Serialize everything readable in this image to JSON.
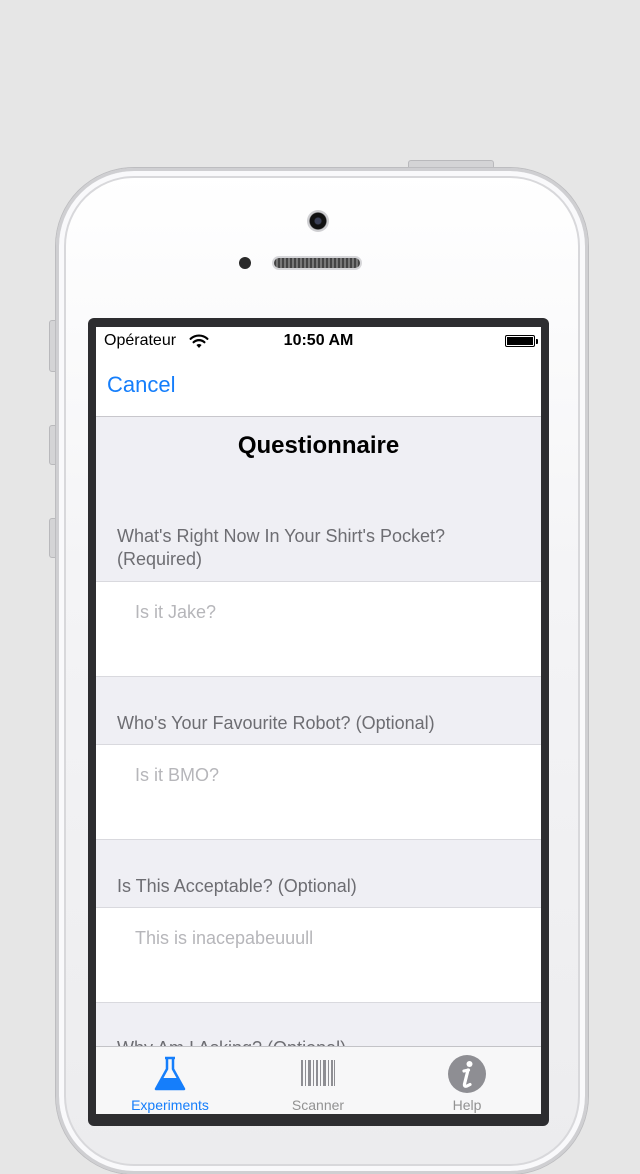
{
  "status_bar": {
    "carrier": "Opérateur",
    "time": "10:50 AM"
  },
  "nav": {
    "cancel_label": "Cancel"
  },
  "page": {
    "title": "Questionnaire"
  },
  "questions": [
    {
      "label": "What's Right Now In Your Shirt's Pocket? (Required)",
      "placeholder": "Is it Jake?"
    },
    {
      "label": "Who's Your Favourite Robot? (Optional)",
      "placeholder": "Is it BMO?"
    },
    {
      "label": "Is This Acceptable? (Optional)",
      "placeholder": "This is inacepabeuuull"
    },
    {
      "label": "Why Am I Asking? (Optional)"
    }
  ],
  "tabbar": {
    "items": [
      {
        "label": "Experiments",
        "icon": "flask-icon",
        "active": true
      },
      {
        "label": "Scanner",
        "icon": "barcode-icon",
        "active": false
      },
      {
        "label": "Help",
        "icon": "info-icon",
        "active": false
      }
    ]
  },
  "colors": {
    "accent": "#157efb",
    "background": "#efeff4",
    "label": "#6d6d72",
    "placeholder": "#b6b6ba",
    "inactive_tab": "#929292"
  }
}
